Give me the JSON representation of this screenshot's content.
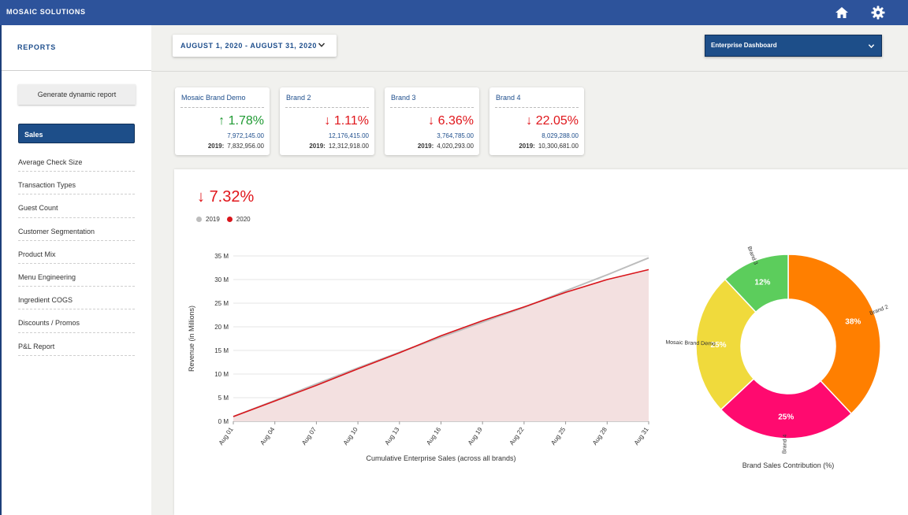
{
  "app": {
    "brand": "MOSAIC SOLUTIONS",
    "home_icon": "home-icon",
    "settings_icon": "gear-icon"
  },
  "sidebar": {
    "title": "REPORTS",
    "generate_button": "Generate dynamic report",
    "items": [
      {
        "label": "Sales",
        "active": true
      },
      {
        "label": "Average Check Size"
      },
      {
        "label": "Transaction Types"
      },
      {
        "label": "Guest Count"
      },
      {
        "label": "Customer Segmentation"
      },
      {
        "label": "Product Mix"
      },
      {
        "label": "Menu Engineering"
      },
      {
        "label": "Ingredient COGS"
      },
      {
        "label": "Discounts / Promos"
      },
      {
        "label": "P&L Report"
      }
    ]
  },
  "header": {
    "date_range": "AUGUST 1, 2020 - AUGUST 31, 2020",
    "dashboard_select": "Enterprise Dashboard"
  },
  "cards": [
    {
      "title": "Mosaic Brand Demo",
      "direction": "up",
      "arrow": "↑",
      "pct": "1.78%",
      "current": "7,972,145.00",
      "prev_label": "2019:",
      "prev": "7,832,956.00"
    },
    {
      "title": "Brand 2",
      "direction": "down",
      "arrow": "↓",
      "pct": "1.11%",
      "current": "12,176,415.00",
      "prev_label": "2019:",
      "prev": "12,312,918.00"
    },
    {
      "title": "Brand 3",
      "direction": "down",
      "arrow": "↓",
      "pct": "6.36%",
      "current": "3,764,785.00",
      "prev_label": "2019:",
      "prev": "4,020,293.00"
    },
    {
      "title": "Brand 4",
      "direction": "down",
      "arrow": "↓",
      "pct": "22.05%",
      "current": "8,029,288.00",
      "prev_label": "2019:",
      "prev": "10,300,681.00"
    }
  ],
  "summary": {
    "arrow": "↓",
    "pct": "7.32%"
  },
  "colors": {
    "accent": "#2d539b",
    "up": "#1f9a33",
    "down": "#e0161b",
    "series_2019": "#bdbdbd",
    "series_2020": "#d9151b",
    "area_fill": "#f3e0e0"
  },
  "chart_data": [
    {
      "type": "area",
      "title": "",
      "xlabel": "Cumulative Enterprise Sales (across all brands)",
      "ylabel": "Revenue (in Millions)",
      "ylim": [
        0,
        35
      ],
      "yticks": [
        "0 M",
        "5 M",
        "10 M",
        "15 M",
        "20 M",
        "25 M",
        "30 M",
        "35 M"
      ],
      "xticks": [
        "Aug 01",
        "Aug 04",
        "Aug 07",
        "Aug 10",
        "Aug 13",
        "Aug 16",
        "Aug 19",
        "Aug 22",
        "Aug 25",
        "Aug 28",
        "Aug 31"
      ],
      "legend": "top-left",
      "grid": true,
      "x_days": [
        1,
        4,
        7,
        10,
        13,
        16,
        19,
        22,
        25,
        28,
        31
      ],
      "series": [
        {
          "name": "2019",
          "values": [
            1.0,
            4.4,
            7.9,
            11.3,
            14.6,
            17.8,
            21.0,
            24.1,
            27.6,
            31.0,
            34.6
          ]
        },
        {
          "name": "2020",
          "values": [
            1.0,
            4.3,
            7.6,
            11.1,
            14.5,
            18.1,
            21.3,
            24.2,
            27.3,
            30.0,
            32.1
          ]
        }
      ]
    },
    {
      "type": "pie",
      "title": "Brand Sales Contribution (%)",
      "labels": [
        "Brand 2",
        "Brand 4",
        "Mosaic Brand Demo",
        "Brand 3"
      ],
      "values": [
        38,
        25,
        25,
        12
      ],
      "value_labels": [
        "38%",
        "25%",
        "25%",
        "12%"
      ],
      "colors": [
        "#ff7f00",
        "#ff0a6f",
        "#f0da3c",
        "#5ccd5c"
      ]
    }
  ]
}
